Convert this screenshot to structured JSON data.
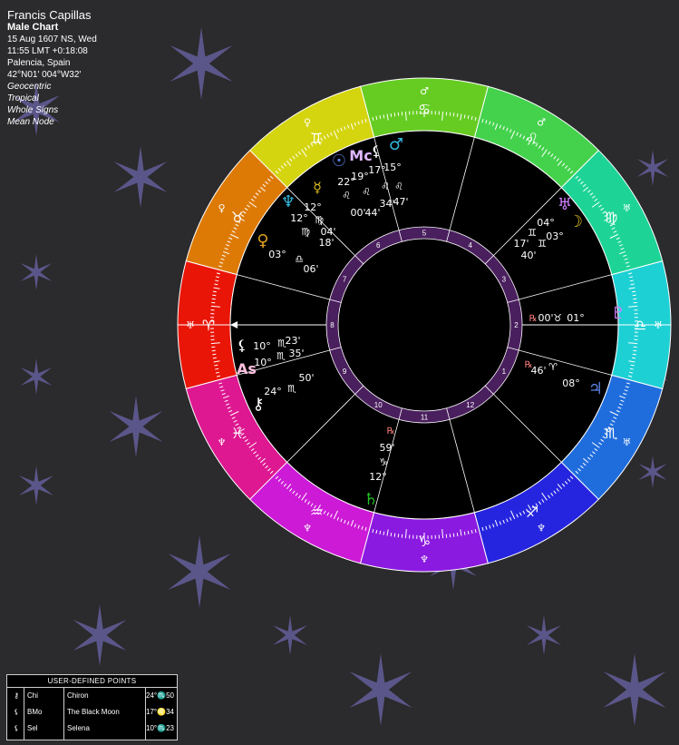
{
  "header": {
    "name": "Francis Capillas",
    "chart_kind": "Male Chart",
    "date_line": "15 Aug 1607 NS, Wed",
    "time_line": "11:55  LMT +0:18:08",
    "place": "Palencia, Spain",
    "coords": "42°N01' 004°W32'",
    "settings": [
      "Geocentric",
      "Tropical",
      "Whole Signs",
      "Mean Node"
    ]
  },
  "colors": {
    "background": "#2b2a2c",
    "star": "#5b5689",
    "chart_bg": "#000000",
    "house_ring": "#4a1f5e"
  },
  "zodiac": [
    {
      "sign": "♌",
      "ruler": "♂",
      "color": "#44d24c"
    },
    {
      "sign": "♋",
      "ruler": "♂",
      "color": "#66cc22"
    },
    {
      "sign": "♊",
      "ruler": "♀",
      "color": "#d4d40f"
    },
    {
      "sign": "♉",
      "ruler": "♀",
      "color": "#dd7a06"
    },
    {
      "sign": "♈",
      "ruler": "♅",
      "color": "#e91507"
    },
    {
      "sign": "♓",
      "ruler": "♆",
      "color": "#dd1890"
    },
    {
      "sign": "♒",
      "ruler": "♆",
      "color": "#cc1ad6"
    },
    {
      "sign": "♑",
      "ruler": "♆",
      "color": "#8b1ae0"
    },
    {
      "sign": "♐",
      "ruler": "♆",
      "color": "#2525e0"
    },
    {
      "sign": "♏",
      "ruler": "♅",
      "color": "#1f6ddd"
    },
    {
      "sign": "♎",
      "ruler": "♅",
      "color": "#1dd0d4"
    },
    {
      "sign": "♍",
      "ruler": "♅",
      "color": "#1dd496"
    }
  ],
  "house_numbers": [
    "1",
    "2",
    "3",
    "4",
    "5",
    "6",
    "7",
    "8",
    "9",
    "10",
    "11",
    "12"
  ],
  "planets": [
    {
      "name": "Sun",
      "glyph": "☉",
      "color": "#5b7fe0",
      "lines": [
        "22°",
        "♌",
        "00'"
      ]
    },
    {
      "name": "Midheaven",
      "glyph": "Mc",
      "color": "#e0b8ff",
      "lines": [
        "19°",
        "♌",
        "44'"
      ]
    },
    {
      "name": "Black Moon",
      "glyph": "⚸",
      "color": "#ffffff",
      "lines": [
        "17°",
        "♌",
        "34'"
      ]
    },
    {
      "name": "Mars",
      "glyph": "♂",
      "color": "#33bbe0",
      "lines": [
        "15°",
        "♌",
        "47'"
      ]
    },
    {
      "name": "Neptune",
      "glyph": "♆",
      "color": "#33bbe0",
      "lines": [
        "12°",
        "♍",
        "04'"
      ]
    },
    {
      "name": "Mercury",
      "glyph": "☿",
      "color": "#e0c020",
      "lines": [
        "12°",
        "♍",
        "18'"
      ]
    },
    {
      "name": "Venus",
      "glyph": "♀",
      "color": "#e0a020",
      "lines": [
        "03°",
        "♎",
        "06'"
      ]
    },
    {
      "name": "Selena",
      "glyph": "⚸",
      "color": "#ffffff",
      "lines": [
        "10°",
        "♏",
        "23'"
      ]
    },
    {
      "name": "Ascendant",
      "glyph": "As",
      "color": "#ffc0e0",
      "lines": [
        "10°",
        "♏",
        "35'"
      ]
    },
    {
      "name": "Chiron",
      "glyph": "⚷",
      "color": "#ffffff",
      "lines": [
        "24°",
        "♏",
        "50'"
      ]
    },
    {
      "name": "Saturn",
      "glyph": "♄",
      "color": "#22c022",
      "lines": [
        "12°",
        "♑",
        "59'",
        "℞"
      ]
    },
    {
      "name": "Jupiter",
      "glyph": "♃",
      "color": "#5b7fe0",
      "lines": [
        "08°",
        "♈",
        "46'",
        "℞"
      ]
    },
    {
      "name": "Pluto",
      "glyph": "♇",
      "color": "#d080ff",
      "lines": [
        "01°",
        "♉",
        "00'",
        "℞"
      ]
    },
    {
      "name": "Uranus",
      "glyph": "♅",
      "color": "#d080ff",
      "lines": [
        "04°",
        "♊",
        "17'"
      ]
    },
    {
      "name": "Moon",
      "glyph": "☽",
      "color": "#e0c020",
      "lines": [
        "03°",
        "♊",
        "40'"
      ]
    }
  ],
  "user_defined_points": {
    "title": "USER-DEFINED POINTS",
    "rows": [
      {
        "glyph": "⚷",
        "abbr": "Chi",
        "name": "Chiron",
        "position": "24°♏50"
      },
      {
        "glyph": "⚸",
        "abbr": "BMo",
        "name": "The Black Moon",
        "position": "17°♌34"
      },
      {
        "glyph": "⚸",
        "abbr": "Sel",
        "name": "Selena",
        "position": "10°♏23"
      }
    ]
  }
}
